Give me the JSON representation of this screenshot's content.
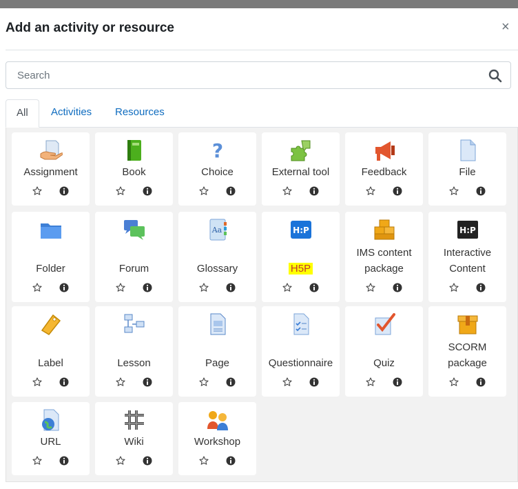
{
  "dialog": {
    "title": "Add an activity or resource",
    "close": "×"
  },
  "search": {
    "placeholder": "Search"
  },
  "tabs": [
    {
      "label": "All",
      "active": true
    },
    {
      "label": "Activities",
      "active": false
    },
    {
      "label": "Resources",
      "active": false
    }
  ],
  "items": [
    {
      "label": "Assignment",
      "icon": "assignment-icon"
    },
    {
      "label": "Book",
      "icon": "book-icon"
    },
    {
      "label": "Choice",
      "icon": "choice-icon"
    },
    {
      "label": "External tool",
      "icon": "external-tool-icon"
    },
    {
      "label": "Feedback",
      "icon": "feedback-icon"
    },
    {
      "label": "File",
      "icon": "file-icon"
    },
    {
      "label": "Folder",
      "icon": "folder-icon"
    },
    {
      "label": "Forum",
      "icon": "forum-icon"
    },
    {
      "label": "Glossary",
      "icon": "glossary-icon"
    },
    {
      "label": "H5P",
      "icon": "h5p-icon",
      "highlighted": true
    },
    {
      "label": "IMS content package",
      "line1": "IMS content",
      "line2": "package",
      "icon": "ims-content-package-icon"
    },
    {
      "label": "Interactive Content",
      "line1": "Interactive",
      "line2": "Content",
      "icon": "interactive-content-icon"
    },
    {
      "label": "Label",
      "icon": "label-icon"
    },
    {
      "label": "Lesson",
      "icon": "lesson-icon"
    },
    {
      "label": "Page",
      "icon": "page-icon"
    },
    {
      "label": "Questionnaire",
      "icon": "questionnaire-icon"
    },
    {
      "label": "Quiz",
      "icon": "quiz-icon"
    },
    {
      "label": "SCORM package",
      "line1": "SCORM",
      "line2": "package",
      "icon": "scorm-package-icon"
    },
    {
      "label": "URL",
      "icon": "url-icon"
    },
    {
      "label": "Wiki",
      "icon": "wiki-icon"
    },
    {
      "label": "Workshop",
      "icon": "workshop-icon"
    }
  ],
  "icons": {
    "h5p_text": "H5P",
    "h5p_alt_text": "H:P",
    "text_badge": "Aa"
  },
  "colors": {
    "link": "#0f6cbf",
    "highlight": "#ffff00",
    "highlight_text": "#c0392b",
    "panel_bg": "#f2f2f2"
  }
}
